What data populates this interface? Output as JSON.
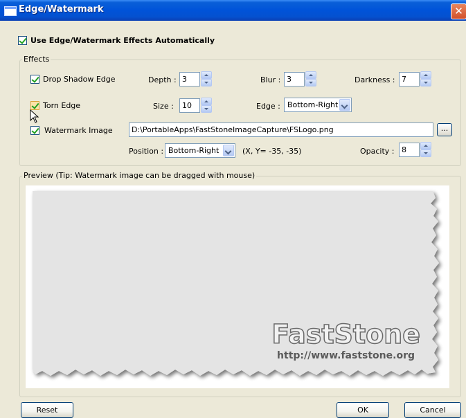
{
  "window": {
    "title": "Edge/Watermark",
    "close_label": "✕"
  },
  "auto_checkbox": {
    "label": "Use Edge/Watermark Effects Automatically",
    "checked": true
  },
  "effects": {
    "group_label": "Effects",
    "drop_shadow": {
      "label": "Drop Shadow Edge",
      "checked": true,
      "depth_label": "Depth :",
      "depth_value": "3",
      "blur_label": "Blur :",
      "blur_value": "3",
      "darkness_label": "Darkness :",
      "darkness_value": "7"
    },
    "torn_edge": {
      "label": "Torn Edge",
      "checked": true,
      "size_label": "Size :",
      "size_value": "10",
      "edge_label": "Edge :",
      "edge_value": "Bottom-Right"
    },
    "watermark": {
      "label": "Watermark Image",
      "checked": true,
      "path": "D:\\PortableApps\\FastStoneImageCapture\\FSLogo.png",
      "browse_label": "...",
      "position_label": "Position :",
      "position_value": "Bottom-Right",
      "coords_text": "(X, Y= -35, -35)",
      "opacity_label": "Opacity :",
      "opacity_value": "8"
    }
  },
  "preview": {
    "group_label": "Preview (Tip: Watermark image can be dragged with mouse)",
    "watermark_title": "FastStone",
    "watermark_url": "http://www.faststone.org"
  },
  "buttons": {
    "reset": "Reset",
    "ok": "OK",
    "cancel": "Cancel"
  },
  "colors": {
    "titlebar": "#0053d9",
    "dialog_bg": "#ece9d8",
    "check_green": "#21a121",
    "preview_paper": "#e4e4e4"
  }
}
